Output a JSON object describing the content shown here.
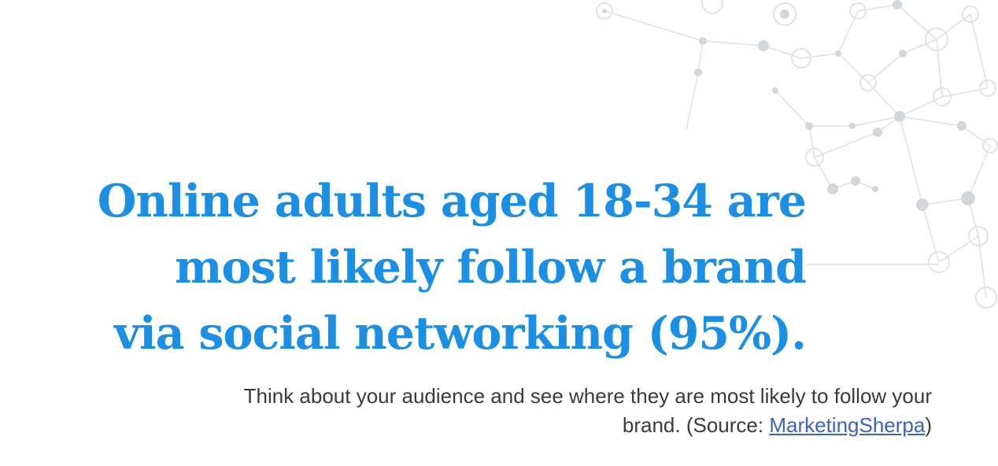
{
  "headline": {
    "line1": "Online adults aged 18-34 are",
    "line2": "most likely follow a brand",
    "line3": "via social networking (95%)."
  },
  "caption": {
    "line1": "Think about your audience and see where they are most likely to follow your",
    "line2_prefix": "brand. (Source: ",
    "source_link": "MarketingSherpa",
    "line2_suffix": ")"
  },
  "colors": {
    "headline": "#1a8fe3",
    "caption": "#3a3a3a",
    "link": "#3b63c4",
    "network": "#d5d9dd"
  }
}
